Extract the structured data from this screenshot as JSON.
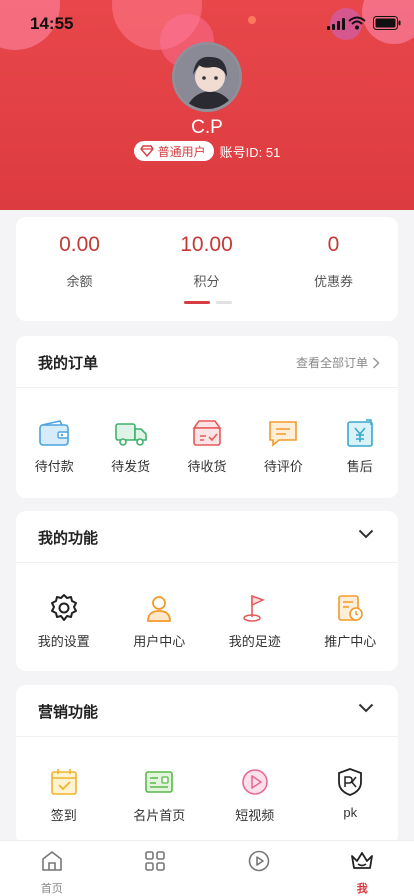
{
  "status_bar": {
    "time": "14:55"
  },
  "profile": {
    "username": "C.P",
    "role": "普通用户",
    "account": "账号ID: 51"
  },
  "stats": [
    {
      "value": "0.00",
      "label": "余额"
    },
    {
      "value": "10.00",
      "label": "积分"
    },
    {
      "value": "0",
      "label": "优惠券"
    }
  ],
  "orders": {
    "title": "我的订单",
    "view_all": "查看全部订单",
    "items": [
      {
        "label": "待付款",
        "icon": "wallet-icon"
      },
      {
        "label": "待发货",
        "icon": "truck-icon"
      },
      {
        "label": "待收货",
        "icon": "package-icon"
      },
      {
        "label": "待评价",
        "icon": "comment-icon"
      },
      {
        "label": "售后",
        "icon": "yen-icon"
      }
    ]
  },
  "functions": {
    "title": "我的功能",
    "items": [
      {
        "label": "我的设置",
        "icon": "gear-icon"
      },
      {
        "label": "用户中心",
        "icon": "user-icon"
      },
      {
        "label": "我的足迹",
        "icon": "flag-icon"
      },
      {
        "label": "推广中心",
        "icon": "promotion-icon"
      }
    ]
  },
  "marketing": {
    "title": "营销功能",
    "items": [
      {
        "label": "签到",
        "icon": "calendar-check-icon"
      },
      {
        "label": "名片首页",
        "icon": "card-icon"
      },
      {
        "label": "短视频",
        "icon": "play-icon"
      },
      {
        "label": "pk",
        "icon": "pk-shield-icon"
      }
    ]
  },
  "tabbar": [
    {
      "label": "首页",
      "icon": "home-icon",
      "active": false
    },
    {
      "label": "",
      "icon": "grid-icon",
      "active": false
    },
    {
      "label": "",
      "icon": "play-circle-icon",
      "active": false
    },
    {
      "label": "我",
      "icon": "crown-icon",
      "active": true
    }
  ],
  "colors": {
    "brand": "#dc3b40",
    "value_red": "#c33a36",
    "active_tab": "#d63c40"
  }
}
